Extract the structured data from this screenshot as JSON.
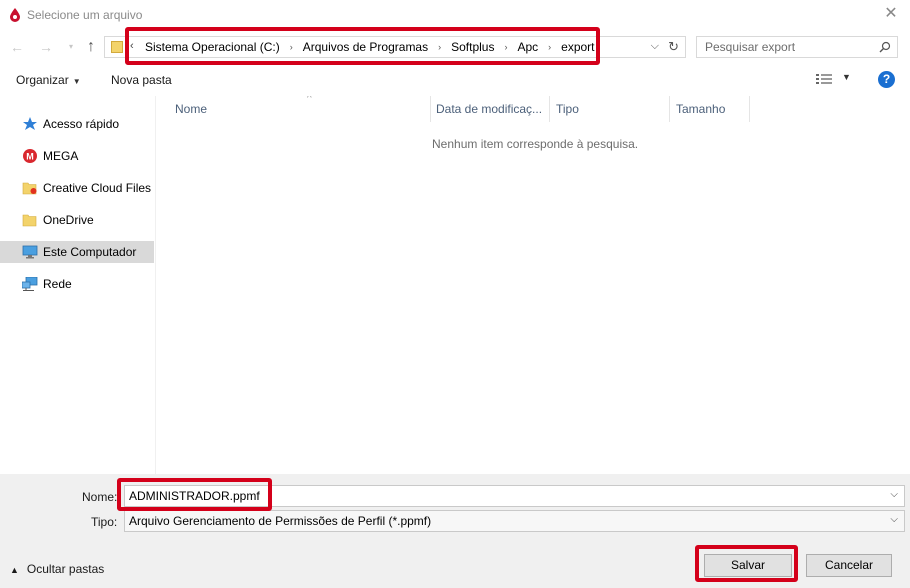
{
  "window": {
    "title": "Selecione um arquivo"
  },
  "navigation": {
    "breadcrumbs": [
      "Sistema Operacional (C:)",
      "Arquivos de Programas",
      "Softplus",
      "Apc",
      "export"
    ],
    "search_placeholder": "Pesquisar export"
  },
  "toolbar": {
    "organize_label": "Organizar",
    "new_folder_label": "Nova pasta"
  },
  "sidebar": {
    "items": [
      {
        "label": "Acesso rápido",
        "icon": "star-icon"
      },
      {
        "label": "MEGA",
        "icon": "mega-icon"
      },
      {
        "label": "Creative Cloud Files",
        "icon": "creative-cloud-folder-icon"
      },
      {
        "label": "OneDrive",
        "icon": "folder-icon"
      },
      {
        "label": "Este Computador",
        "icon": "computer-icon",
        "selected": true
      },
      {
        "label": "Rede",
        "icon": "network-icon"
      }
    ]
  },
  "file_list": {
    "columns": [
      "Nome",
      "Data de modificaç...",
      "Tipo",
      "Tamanho"
    ],
    "empty_message": "Nenhum item corresponde à pesquisa."
  },
  "save_form": {
    "name_label": "Nome:",
    "name_value": "ADMINISTRADOR.ppmf",
    "type_label": "Tipo:",
    "type_value": "Arquivo Gerenciamento de Permissões de Perfil (*.ppmf)",
    "hide_folders_label": "Ocultar pastas",
    "save_label": "Salvar",
    "cancel_label": "Cancelar"
  },
  "colors": {
    "highlight": "#d4001a",
    "help_icon": "#1a6fd1",
    "selected_item": "#d9d9d9"
  }
}
